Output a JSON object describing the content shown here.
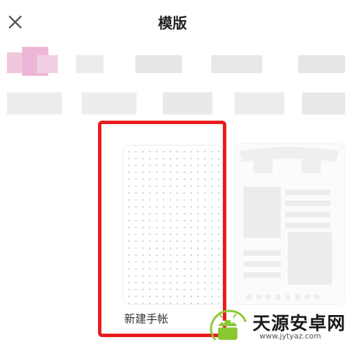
{
  "header": {
    "title": "模版",
    "close_icon": "close-icon"
  },
  "templates": {
    "new_card_label": "新建手帐"
  },
  "watermark": {
    "brand": "天源安卓网",
    "url": "www.jytyaz.com"
  },
  "colors": {
    "highlight": "#e81c1c",
    "pink_accent": "#eeb6d6"
  }
}
